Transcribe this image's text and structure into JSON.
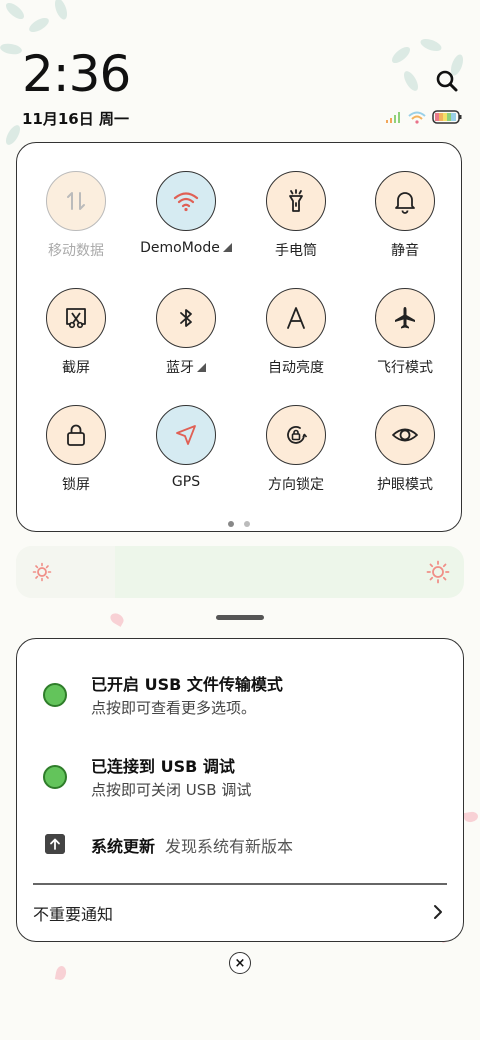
{
  "status": {
    "time": "2:36",
    "date": "11月16日 周一"
  },
  "quick_settings": {
    "tiles": [
      {
        "label": "移动数据",
        "icon": "mobile-data-icon",
        "state": "disabled"
      },
      {
        "label": "DemoMode",
        "icon": "wifi-icon",
        "state": "on",
        "expand": true
      },
      {
        "label": "手电筒",
        "icon": "flashlight-icon",
        "state": "off"
      },
      {
        "label": "静音",
        "icon": "bell-icon",
        "state": "off"
      },
      {
        "label": "截屏",
        "icon": "screenshot-icon",
        "state": "off"
      },
      {
        "label": "蓝牙",
        "icon": "bluetooth-icon",
        "state": "off",
        "expand": true
      },
      {
        "label": "自动亮度",
        "icon": "auto-brightness-icon",
        "state": "off"
      },
      {
        "label": "飞行模式",
        "icon": "airplane-icon",
        "state": "off"
      },
      {
        "label": "锁屏",
        "icon": "lock-icon",
        "state": "off"
      },
      {
        "label": "GPS",
        "icon": "location-icon",
        "state": "on"
      },
      {
        "label": "方向锁定",
        "icon": "rotation-lock-icon",
        "state": "off"
      },
      {
        "label": "护眼模式",
        "icon": "eye-icon",
        "state": "off"
      }
    ],
    "page_count": 2,
    "active_page": 1
  },
  "brightness": {
    "level": 0.22
  },
  "notifications": [
    {
      "title": "已开启 USB 文件传输模式",
      "text": "点按即可查看更多选项。",
      "icon": "android-icon"
    },
    {
      "title": "已连接到 USB 调试",
      "text": "点按即可关闭 USB 调试",
      "icon": "android-icon"
    },
    {
      "title": "系统更新",
      "text": "发现系统有新版本",
      "icon": "upload-icon"
    }
  ],
  "unimportant_label": "不重要通知",
  "close_all_symbol": "×",
  "colors": {
    "tile_off": "#fdebd8",
    "tile_on": "#d6ebf2",
    "wifi_accent": "#e06055",
    "brightness_track": "#edf6ea"
  }
}
